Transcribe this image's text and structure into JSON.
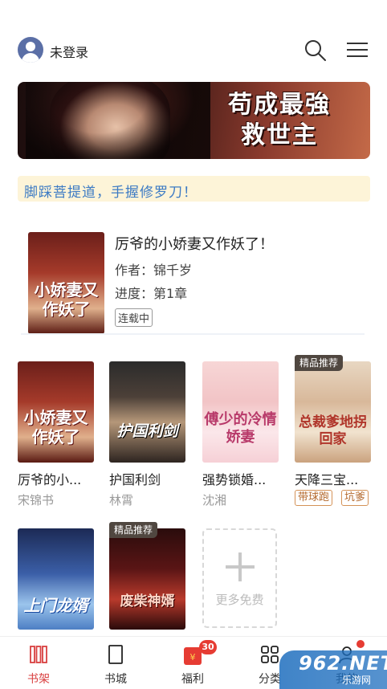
{
  "header": {
    "login_label": "未登录"
  },
  "banner": {
    "title_line1": "苟成最強",
    "title_line2": "救世主"
  },
  "notice": {
    "text": "脚踩菩提道，手握修罗刀！"
  },
  "featured": {
    "title": "厉爷的小娇妻又作妖了！",
    "author": "作者：锦千岁",
    "progress": "进度：第1章",
    "status": "连载中",
    "cover_text": "小娇妻又作妖了"
  },
  "books": [
    {
      "name": "厉爷的小...",
      "author": "宋锦书",
      "cover_text": "小娇妻又作妖了"
    },
    {
      "name": "护国利剑",
      "author": "林霄",
      "cover_text": "护国利剑"
    },
    {
      "name": "强势锁婚...",
      "author": "沈湘",
      "cover_text": "傅少的冷情娇妻"
    },
    {
      "name": "天降三宝...",
      "badge": "精品推荐",
      "tags": [
        "带球跑",
        "坑爹"
      ],
      "cover_text": "总裁爹地拐回家"
    },
    {
      "cover_text": "上门龙婿"
    },
    {
      "badge": "精品推荐",
      "cover_text": "废柴神婿"
    }
  ],
  "more_free": {
    "label": "更多免费"
  },
  "tabbar": {
    "tabs": [
      {
        "label": "书架",
        "active": true
      },
      {
        "label": "书城"
      },
      {
        "label": "福利",
        "badge": "30"
      },
      {
        "label": "分类"
      },
      {
        "label": "我的"
      }
    ]
  },
  "watermark": {
    "big": "962.NET",
    "small": "乐游网"
  },
  "colors": {
    "accent_red": "#d94040",
    "notice_bg": "#fdf4d8",
    "notice_text": "#3d7bc4",
    "badge_bg": "#504740",
    "tag_border": "#d49257"
  }
}
